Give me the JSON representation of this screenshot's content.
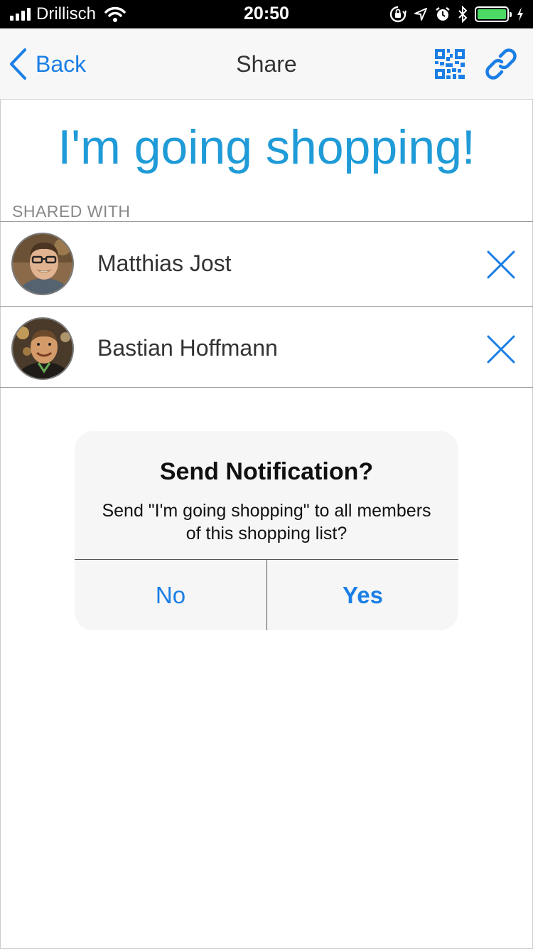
{
  "status_bar": {
    "carrier": "Drillisch",
    "time": "20:50",
    "battery_level": 1.0,
    "battery_color": "#4cd964"
  },
  "nav": {
    "back_label": "Back",
    "title": "Share",
    "icons": [
      "chevron-left-icon",
      "qr-code-icon",
      "link-icon"
    ],
    "accent_color": "#1a7ee6"
  },
  "list": {
    "title": "I'm going shopping!",
    "title_color": "#1f9bd7",
    "section_header": "SHARED WITH",
    "members": [
      {
        "name": "Matthias Jost"
      },
      {
        "name": "Bastian Hoffmann"
      }
    ]
  },
  "alert": {
    "title": "Send Notification?",
    "message": "Send \"I'm going shopping\" to all members of this shopping list?",
    "no_label": "No",
    "yes_label": "Yes"
  }
}
